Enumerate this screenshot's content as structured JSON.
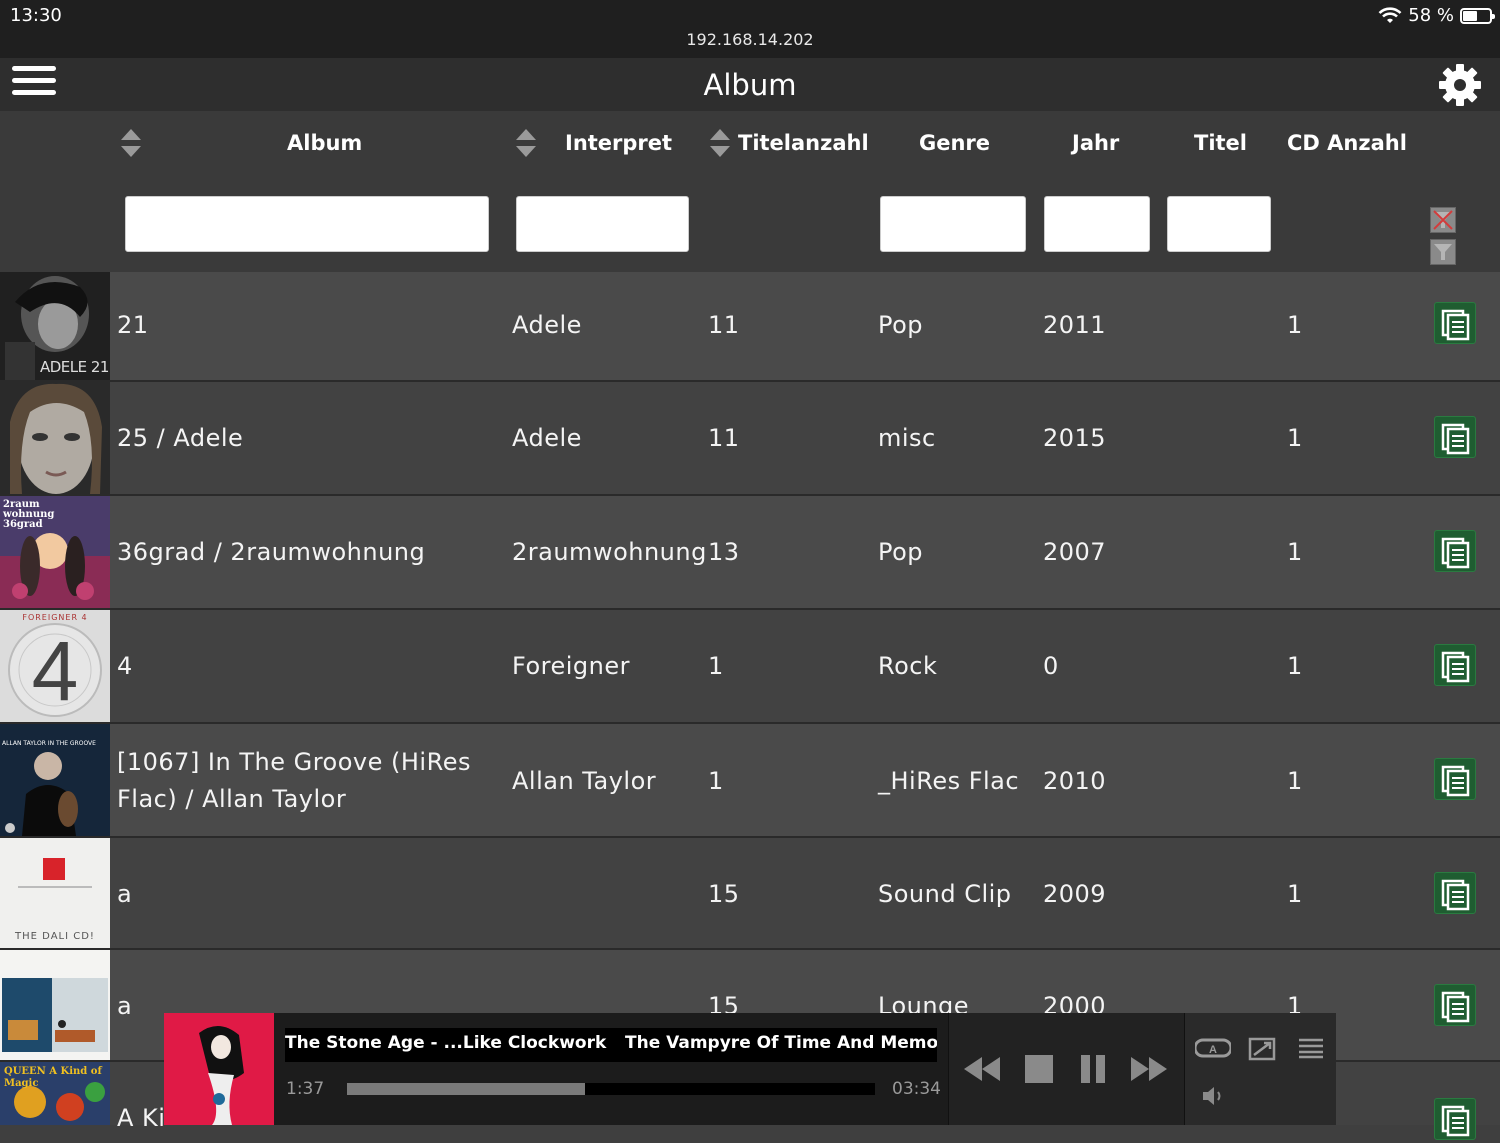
{
  "status": {
    "time": "13:30",
    "url": "192.168.14.202",
    "battery": "58 %",
    "battery_level": 0.58
  },
  "header": {
    "title": "Album"
  },
  "columns": [
    "Album",
    "Interpret",
    "Titelanzahl",
    "Genre",
    "Jahr",
    "Titel",
    "CD Anzahl"
  ],
  "rows": [
    {
      "album": "21",
      "artist": "Adele",
      "tracks": "11",
      "genre": "Pop",
      "year": "2011",
      "cds": "1",
      "cover_text": "ADELE 21"
    },
    {
      "album": "25 / Adele",
      "artist": "Adele",
      "tracks": "11",
      "genre": "misc",
      "year": "2015",
      "cds": "1"
    },
    {
      "album": "36grad / 2raumwohnung",
      "artist": "2raumwohnung",
      "tracks": "13",
      "genre": "Pop",
      "year": "2007",
      "cds": "1",
      "cover_text": "2raum wohnung 36grad"
    },
    {
      "album": "4",
      "artist": "Foreigner",
      "tracks": "1",
      "genre": "Rock",
      "year": "0",
      "cds": "1",
      "cover_text": "FOREIGNER 4"
    },
    {
      "album": "[1067] In The Groove (HiRes Flac) / Allan Taylor",
      "artist": "Allan Taylor",
      "tracks": "1",
      "genre": "_HiRes Flac",
      "year": "2010",
      "cds": "1",
      "cover_text": "ALLAN TAYLOR IN THE GROOVE"
    },
    {
      "album": "a",
      "artist": "",
      "tracks": "15",
      "genre": "Sound Clip",
      "year": "2009",
      "cds": "1",
      "cover_text": "THE DALI CD!"
    },
    {
      "album": "a",
      "artist": "",
      "tracks": "15",
      "genre": "Lounge",
      "year": "2000",
      "cds": "1"
    },
    {
      "album": "A Ki",
      "artist": "",
      "tracks": "",
      "genre": "",
      "year": "",
      "cds": "",
      "cover_text": "QUEEN A Kind of Magic"
    }
  ],
  "player": {
    "track_left": "The Stone Age - ...Like Clockwork",
    "track_right": "The Vampyre Of Time And Memory - Q",
    "elapsed": "1:37",
    "duration": "03:34",
    "progress": 0.45
  },
  "icons": {
    "menu": "menu-icon",
    "settings": "gear-icon",
    "sort": "sort-icon",
    "filter_clear": "filter-clear-icon",
    "filter_apply": "filter-icon",
    "row_action": "playlist-add-icon",
    "rewind": "rewind-icon",
    "stop": "stop-icon",
    "pause": "pause-icon",
    "forward": "fast-forward-icon",
    "repeat": "repeat-icon",
    "shuffle": "shuffle-icon",
    "queue": "queue-icon",
    "volume": "volume-icon"
  },
  "colors": {
    "accent_green": "#1f5d31",
    "player_red": "#e01a46"
  }
}
